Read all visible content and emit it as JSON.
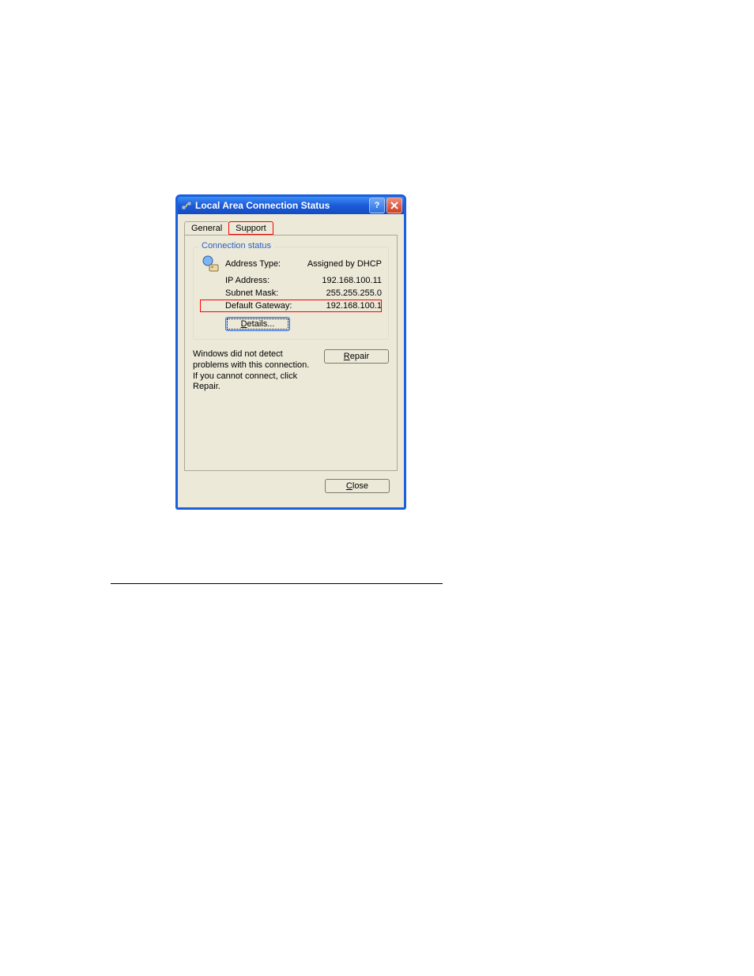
{
  "title": "Local Area Connection Status",
  "tabs": {
    "general": "General",
    "support": "Support"
  },
  "group_title": "Connection status",
  "fields": {
    "address_type": {
      "label": "Address Type:",
      "value": "Assigned by DHCP"
    },
    "ip_address": {
      "label": "IP Address:",
      "value": "192.168.100.11"
    },
    "subnet_mask": {
      "label": "Subnet Mask:",
      "value": "255.255.255.0"
    },
    "default_gateway": {
      "label": "Default Gateway:",
      "value": "192.168.100.1"
    }
  },
  "buttons": {
    "details_mnemonic": "D",
    "details_rest": "etails...",
    "repair_mnemonic": "R",
    "repair_rest": "epair",
    "close_mnemonic": "C",
    "close_rest": "lose"
  },
  "repair_message": "Windows did not detect problems with this connection. If you cannot connect, click Repair."
}
